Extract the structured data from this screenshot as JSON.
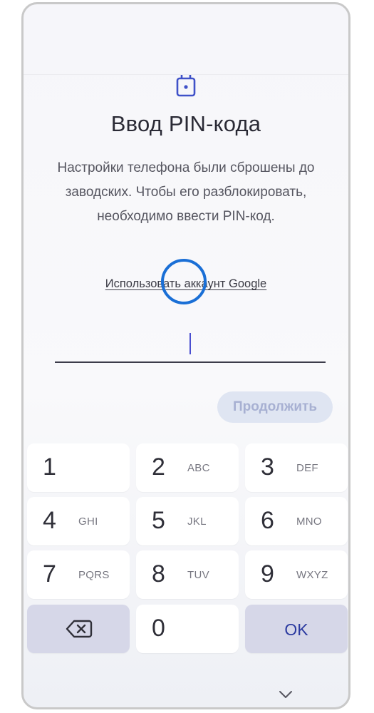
{
  "screen": {
    "title": "Ввод PIN-кода",
    "description": "Настройки телефона были сброшены до заводских. Чтобы его разблокировать, необходимо ввести PIN-код.",
    "google_link": "Использовать аккаунт Google",
    "continue_label": "Продолжить",
    "icons": {
      "sim": "sim-card-icon",
      "backspace": "backspace-icon",
      "collapse": "chevron-down-icon"
    },
    "colors": {
      "highlight": "#1a6fd6",
      "accent": "#4a4fd0",
      "ok": "#2b3aa0"
    }
  },
  "keypad": {
    "keys": [
      {
        "digit": "1",
        "letters": ""
      },
      {
        "digit": "2",
        "letters": "ABC"
      },
      {
        "digit": "3",
        "letters": "DEF"
      },
      {
        "digit": "4",
        "letters": "GHI"
      },
      {
        "digit": "5",
        "letters": "JKL"
      },
      {
        "digit": "6",
        "letters": "MNO"
      },
      {
        "digit": "7",
        "letters": "PQRS"
      },
      {
        "digit": "8",
        "letters": "TUV"
      },
      {
        "digit": "9",
        "letters": "WXYZ"
      },
      {
        "digit": "0",
        "letters": ""
      }
    ],
    "ok_label": "OK"
  }
}
